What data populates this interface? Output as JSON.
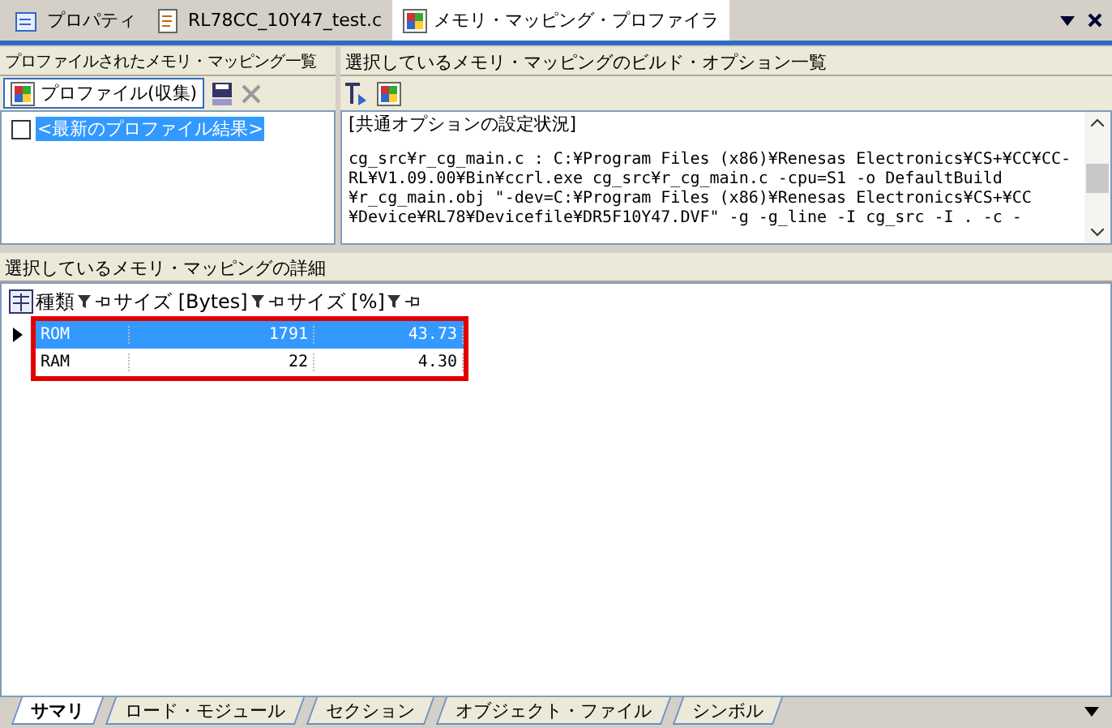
{
  "doc_tabs": [
    {
      "label": "プロパティ",
      "selected": false
    },
    {
      "label": "RL78CC_10Y47_test.c",
      "selected": false
    },
    {
      "label": "メモリ・マッピング・プロファイラ",
      "selected": true
    }
  ],
  "left_pane": {
    "title": "プロファイルされたメモリ・マッピング一覧",
    "profile_button": "プロファイル(収集)",
    "items": [
      {
        "label": "<最新のプロファイル結果>",
        "checked": false,
        "selected": true
      }
    ]
  },
  "right_pane": {
    "title": "選択しているメモリ・マッピングのビルド・オプション一覧",
    "heading": "[共通オプションの設定状況]",
    "lines": [
      "cg_src¥r_cg_main.c : C:¥Program Files (x86)¥Renesas Electronics¥CS+¥CC¥CC-",
      "RL¥V1.09.00¥Bin¥ccrl.exe cg_src¥r_cg_main.c -cpu=S1 -o DefaultBuild",
      "¥r_cg_main.obj \"-dev=C:¥Program Files (x86)¥Renesas Electronics¥CS+¥CC",
      "¥Device¥RL78¥Devicefile¥DR5F10Y47.DVF\" -g -g_line -I cg_src -I . -c -"
    ]
  },
  "detail": {
    "title": "選択しているメモリ・マッピングの詳細",
    "columns": [
      "種類",
      "サイズ [Bytes]",
      "サイズ [%]"
    ],
    "rows": [
      {
        "cells": [
          "ROM",
          "1791",
          "43.73"
        ],
        "selected": true
      },
      {
        "cells": [
          "RAM",
          "22",
          "4.30"
        ],
        "selected": false
      }
    ]
  },
  "bottom_tabs": [
    {
      "label": "サマリ",
      "selected": true
    },
    {
      "label": "ロード・モジュール",
      "selected": false
    },
    {
      "label": "セクション",
      "selected": false
    },
    {
      "label": "オブジェクト・ファイル",
      "selected": false
    },
    {
      "label": "シンボル",
      "selected": false
    }
  ]
}
